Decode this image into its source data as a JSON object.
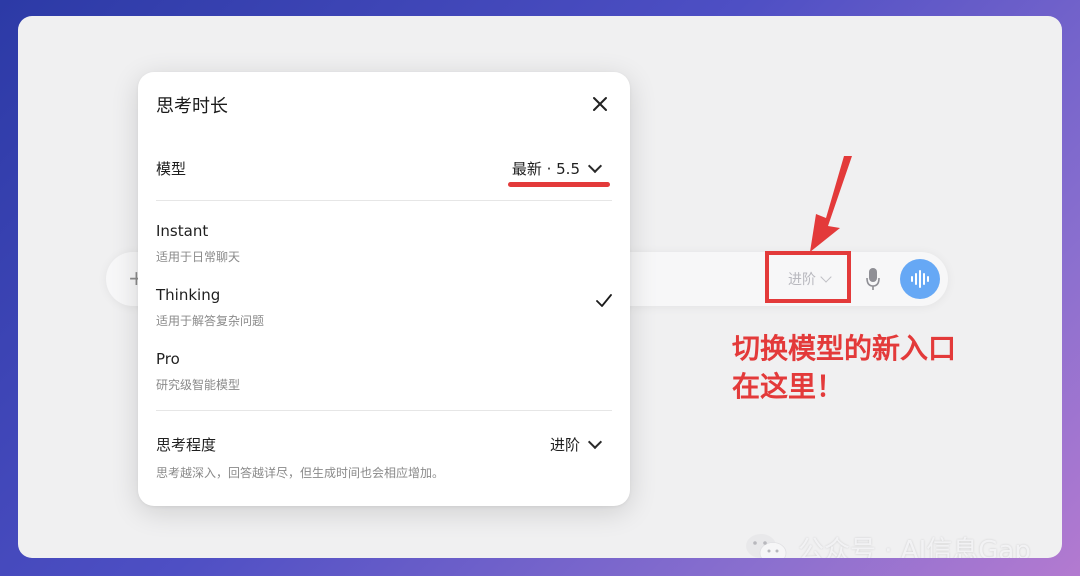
{
  "popover": {
    "title": "思考时长",
    "model_label": "模型",
    "model_value": "最新 · 5.5",
    "options": [
      {
        "name": "Instant",
        "desc": "适用于日常聊天",
        "selected": false
      },
      {
        "name": "Thinking",
        "desc": "适用于解答复杂问题",
        "selected": true
      },
      {
        "name": "Pro",
        "desc": "研究级智能模型",
        "selected": false
      }
    ],
    "depth_label": "思考程度",
    "depth_value": "进阶",
    "depth_hint": "思考越深入，回答越详尽，但生成时间也会相应增加。"
  },
  "composer": {
    "advanced_label": "进阶"
  },
  "annotation": {
    "line1": "切换模型的新入口",
    "line2": "在这里！"
  },
  "watermark": {
    "text": "公众号 · AI信息Gap"
  },
  "icons": {
    "close": "close-icon",
    "check": "check-icon",
    "chevron": "chevron-down-icon",
    "mic": "microphone-icon",
    "voice": "voice-mode-icon",
    "plus": "plus-icon",
    "wechat": "wechat-icon"
  },
  "colors": {
    "annotation_red": "#e33a3a",
    "voice_blue": "#66a8f5"
  }
}
